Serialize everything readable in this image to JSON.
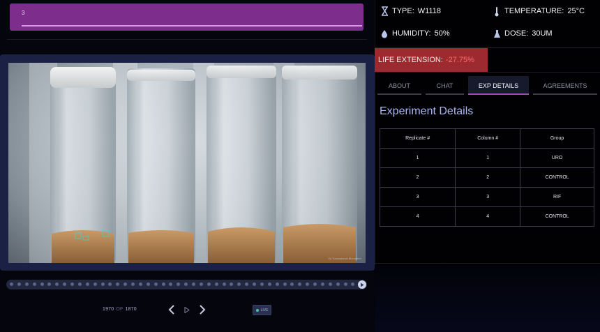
{
  "replicate_selector": {
    "value": "3"
  },
  "video": {
    "watermark": "Vy Translational Biomarker"
  },
  "playback": {
    "current_frame": "1970",
    "of_label": "OF",
    "total_frames": "1870",
    "live_label": "LIVE",
    "timeline_dot_count": 46
  },
  "stats": {
    "type_label": "TYPE:",
    "type_value": "W1118",
    "temperature_label": "TEMPERATURE:",
    "temperature_value": "25°C",
    "humidity_label": "HUMIDITY:",
    "humidity_value": "50%",
    "dose_label": "DOSE:",
    "dose_value": "30UM"
  },
  "life_extension": {
    "label": "LIFE EXTENSION:",
    "value": "-27.75%"
  },
  "tabs": [
    {
      "label": "ABOUT",
      "active": false
    },
    {
      "label": "CHAT",
      "active": false
    },
    {
      "label": "EXP DETAILS",
      "active": true
    },
    {
      "label": "AGREEMENTS",
      "active": false
    }
  ],
  "experiment": {
    "title": "Experiment Details",
    "headers": [
      "Replicate #",
      "Column #",
      "Group"
    ],
    "rows": [
      [
        "1",
        "1",
        "URO"
      ],
      [
        "2",
        "2",
        "CONTROL"
      ],
      [
        "3",
        "3",
        "RIF"
      ],
      [
        "4",
        "4",
        "CONTROL"
      ]
    ]
  },
  "colors": {
    "accent_purple": "#7d2d8c",
    "tab_underline_active": "#9d49b8",
    "life_extension_bg": "#9c2a2f",
    "title_blue": "#a9b6f2"
  }
}
